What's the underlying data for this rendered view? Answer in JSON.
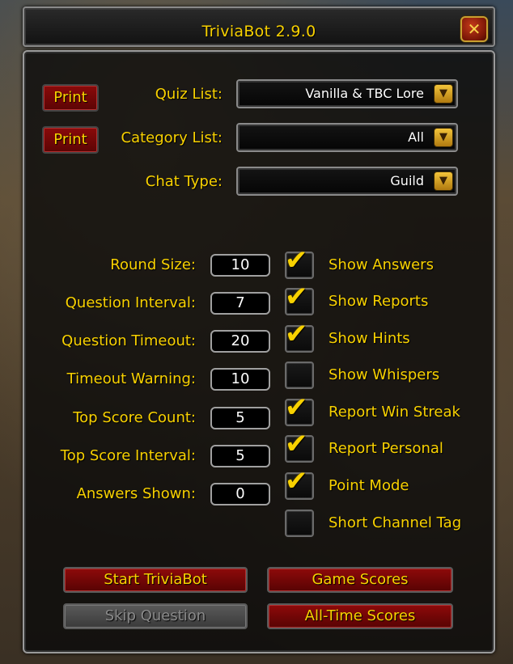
{
  "window": {
    "title": "TriviaBot 2.9.0",
    "close_icon": "close-icon"
  },
  "selectors": [
    {
      "key": "quiz",
      "label": "Quiz List:",
      "value": "Vanilla & TBC Lore",
      "print_label": "Print"
    },
    {
      "key": "category",
      "label": "Category List:",
      "value": "All",
      "print_label": "Print"
    },
    {
      "key": "chat",
      "label": "Chat Type:",
      "value": "Guild"
    }
  ],
  "settings": [
    {
      "label": "Round Size:",
      "value": "10"
    },
    {
      "label": "Question Interval:",
      "value": "7"
    },
    {
      "label": "Question Timeout:",
      "value": "20"
    },
    {
      "label": "Timeout Warning:",
      "value": "10"
    },
    {
      "label": "Top Score Count:",
      "value": "5"
    },
    {
      "label": "Top Score Interval:",
      "value": "5"
    },
    {
      "label": "Answers Shown:",
      "value": "0"
    }
  ],
  "options": [
    {
      "label": "Show Answers",
      "checked": true
    },
    {
      "label": "Show Reports",
      "checked": true
    },
    {
      "label": "Show Hints",
      "checked": true
    },
    {
      "label": "Show Whispers",
      "checked": false
    },
    {
      "label": "Report Win Streak",
      "checked": true
    },
    {
      "label": "Report Personal",
      "checked": true
    },
    {
      "label": "Point Mode",
      "checked": true
    },
    {
      "label": "Short Channel Tag",
      "checked": false
    }
  ],
  "buttons": {
    "start": "Start TriviaBot",
    "game_scores": "Game Scores",
    "skip": "Skip Question",
    "all_time": "All-Time Scores"
  },
  "colors": {
    "label_gold": "#f8d100",
    "button_red": "#8e0a0a",
    "value_white": "#ffffff"
  }
}
